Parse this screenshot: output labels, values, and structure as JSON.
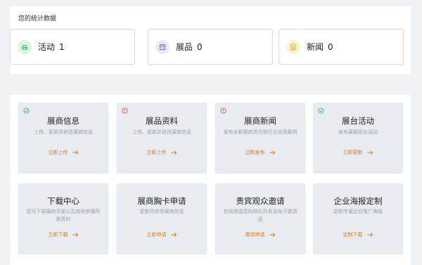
{
  "stats": {
    "title": "您的统计数据",
    "items": [
      {
        "label": "展品",
        "value": "0",
        "icon": "exhibit-icon",
        "icon_bg": "#ece8fb",
        "icon_color": "#7b68d8"
      },
      {
        "label": "新闻",
        "value": "0",
        "icon": "document-icon",
        "icon_bg": "#fdf3d3",
        "icon_color": "#e0a72a"
      },
      {
        "label": "活动",
        "value": "1",
        "icon": "car-icon",
        "icon_bg": "#dcf4e4",
        "icon_color": "#3fb86a"
      }
    ]
  },
  "services": [
    {
      "title": "展商信息",
      "desc": "上传、更新并修改展商信息",
      "action": "立即上传",
      "status": "check",
      "status_color": "#38b58a"
    },
    {
      "title": "展品资料",
      "desc": "上传、更新并修改展商信息",
      "action": "立即上传",
      "status": "alert",
      "status_color": "#e05252"
    },
    {
      "title": "展商新闻",
      "desc": "发布全新展商资讯和行业应用案例",
      "action": "立即发布",
      "status": "alert",
      "status_color": "#e05252"
    },
    {
      "title": "展台活动",
      "desc": "发布展期现台活动",
      "action": "立即更新",
      "status": "check",
      "status_color": "#38b58a"
    },
    {
      "title": "下载中心",
      "desc": "您可下载展商手册以及其他参展所需资料",
      "action": "立即下载",
      "status": "",
      "status_color": ""
    },
    {
      "title": "展商胸卡申请",
      "desc": "更新并修改展商信息",
      "action": "立即申请",
      "status": "",
      "status_color": ""
    },
    {
      "title": "贵宾观众邀请",
      "desc": "在线邀请您的观众并发送电子邀请函",
      "action": "邀请申请",
      "status": "",
      "status_color": ""
    },
    {
      "title": "企业海报定制",
      "desc": "定制专属企业推广海报",
      "action": "定制下载",
      "status": "",
      "status_color": ""
    }
  ],
  "colors": {
    "accent": "#e07b21",
    "card_bg": "#e8ebf0",
    "page_bg": "#f1f2f5"
  }
}
